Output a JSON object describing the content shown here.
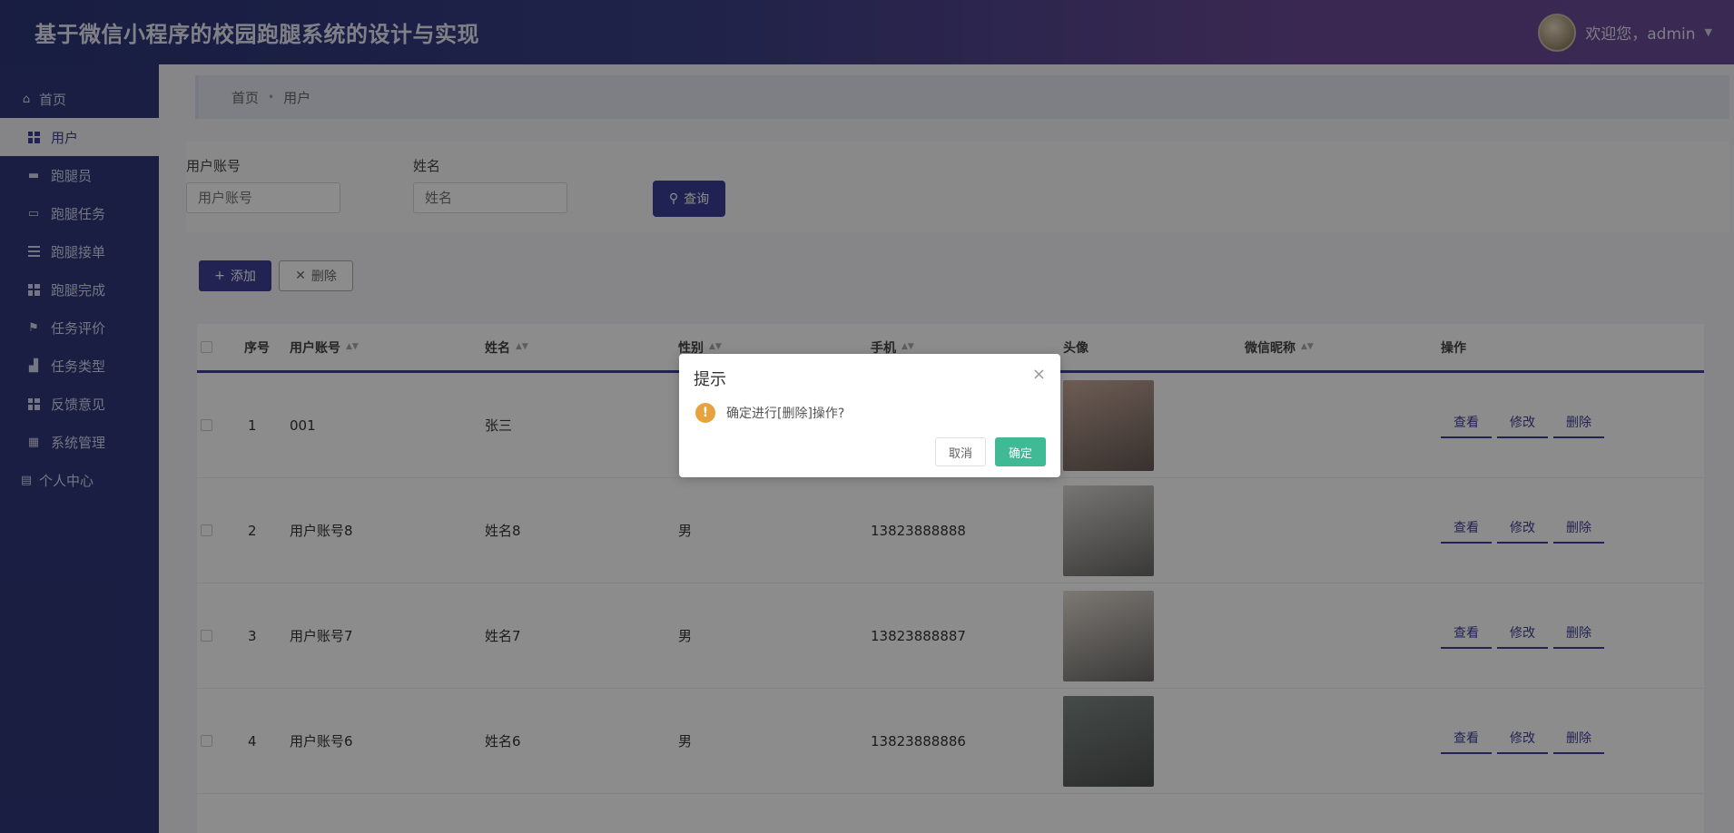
{
  "header": {
    "title": "基于微信小程序的校园跑腿系统的设计与实现",
    "welcome": "欢迎您，admin"
  },
  "sidebar": {
    "home": "首页",
    "items": [
      {
        "label": "用户",
        "icon": "grid-icon",
        "active": true
      },
      {
        "label": "跑腿员",
        "icon": "chat-icon",
        "active": false
      },
      {
        "label": "跑腿任务",
        "icon": "monitor-icon",
        "active": false
      },
      {
        "label": "跑腿接单",
        "icon": "list-icon",
        "active": false
      },
      {
        "label": "跑腿完成",
        "icon": "grid-icon",
        "active": false
      },
      {
        "label": "任务评价",
        "icon": "flag-icon",
        "active": false
      },
      {
        "label": "任务类型",
        "icon": "thumb-icon",
        "active": false
      },
      {
        "label": "反馈意见",
        "icon": "grid-icon",
        "active": false
      },
      {
        "label": "系统管理",
        "icon": "table-icon",
        "active": false
      }
    ],
    "profile": "个人中心"
  },
  "breadcrumb": {
    "home": "首页",
    "sep": "•",
    "current": "用户"
  },
  "search": {
    "account_label": "用户账号",
    "account_placeholder": "用户账号",
    "name_label": "姓名",
    "name_placeholder": "姓名",
    "query_button": "查询"
  },
  "actions": {
    "add": "添加",
    "delete": "删除"
  },
  "table": {
    "headers": {
      "index": "序号",
      "account": "用户账号",
      "name": "姓名",
      "gender": "性别",
      "phone": "手机",
      "avatar": "头像",
      "wechat": "微信昵称",
      "ops": "操作"
    },
    "rows": [
      {
        "index": "1",
        "account": "001",
        "name": "张三",
        "gender": "",
        "phone": "",
        "avatar_color": "#c9a99a"
      },
      {
        "index": "2",
        "account": "用户账号8",
        "name": "姓名8",
        "gender": "男",
        "phone": "13823888888",
        "avatar_color": "#d8d6d2"
      },
      {
        "index": "3",
        "account": "用户账号7",
        "name": "姓名7",
        "gender": "男",
        "phone": "13823888887",
        "avatar_color": "#e2dcd3"
      },
      {
        "index": "4",
        "account": "用户账号6",
        "name": "姓名6",
        "gender": "男",
        "phone": "13823888886",
        "avatar_color": "#7f8a86"
      }
    ],
    "op_view": "查看",
    "op_edit": "修改",
    "op_delete": "删除"
  },
  "dialog": {
    "title": "提示",
    "close": "×",
    "message": "确定进行[删除]操作?",
    "cancel": "取消",
    "confirm": "确定"
  },
  "colors": {
    "primary": "#3e3f98",
    "confirm": "#3fba94",
    "warning": "#e6a23c"
  }
}
